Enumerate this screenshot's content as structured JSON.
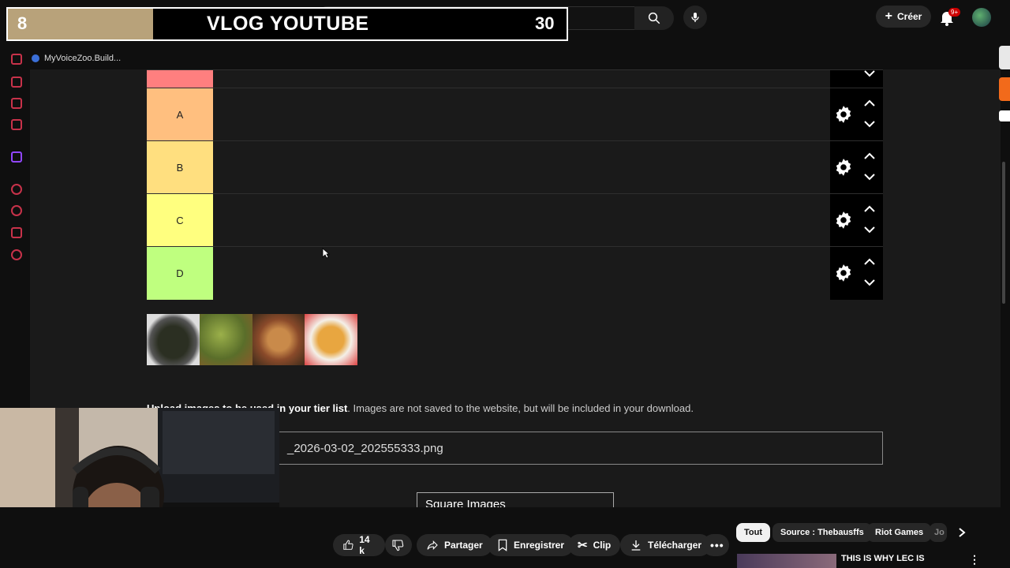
{
  "overlay": {
    "left_number": "8",
    "title": "VLOG YOUTUBE",
    "right_number": "30"
  },
  "header": {
    "create_label": "Créer",
    "notification_badge": "9+"
  },
  "bookmarks": {
    "item_label": "MyVoiceZoo.Build..."
  },
  "tierlist": {
    "rows": [
      {
        "label": "",
        "color": "#ff7f7f"
      },
      {
        "label": "A",
        "color": "#ffbf7f"
      },
      {
        "label": "B",
        "color": "#ffdf7f"
      },
      {
        "label": "C",
        "color": "#ffff7f"
      },
      {
        "label": "D",
        "color": "#bfff7f"
      }
    ]
  },
  "upload": {
    "bold_text": "Upload images to be used in your tier list",
    "rest_text": ". Images are not saved to the website, but will be included in your download.",
    "file_name": "_2026-03-02_202555333.png",
    "select_value": "Square Images"
  },
  "actions": {
    "like_count": "14 k",
    "share_label": "Partager",
    "save_label": "Enregistrer",
    "clip_label": "Clip",
    "download_label": "Télécharger"
  },
  "chips": {
    "all": "Tout",
    "source": "Source : Thebausffs",
    "riot": "Riot Games",
    "partial": "Jo"
  },
  "recommended": {
    "title": "THIS IS WHY LEC IS"
  }
}
